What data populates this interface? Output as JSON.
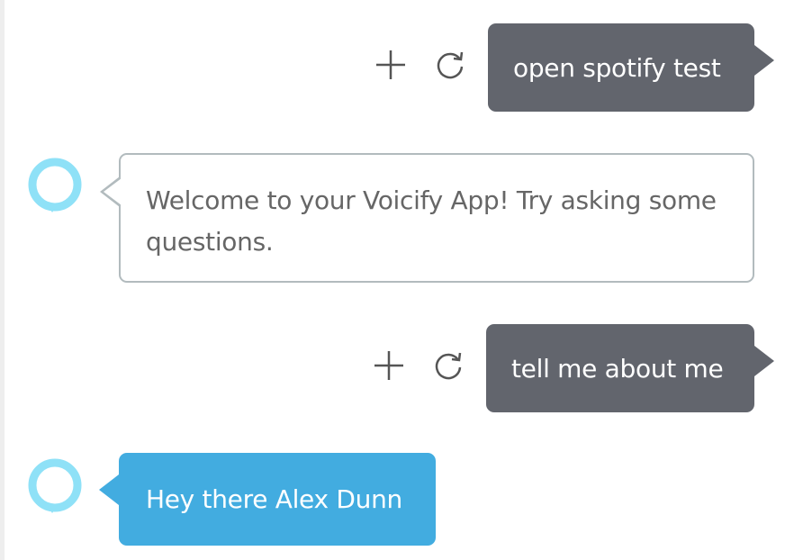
{
  "colors": {
    "user_bubble": "#62656d",
    "bot_bubble_border": "#b2bbbe",
    "bot_bubble_highlight": "#42ace0",
    "avatar_ring": "#8fe1f7",
    "icon_stroke": "#555555"
  },
  "conversation": {
    "messages": [
      {
        "role": "user",
        "text": "open spotify test",
        "actions": [
          "plus-icon",
          "refresh-icon"
        ]
      },
      {
        "role": "assistant",
        "text": "Welcome to your Voicify App! Try asking some questions.",
        "avatar": "alexa-icon"
      },
      {
        "role": "user",
        "text": "tell me about me",
        "actions": [
          "plus-icon",
          "refresh-icon"
        ]
      },
      {
        "role": "assistant",
        "text": "Hey there Alex Dunn",
        "avatar": "alexa-icon",
        "highlighted": true
      }
    ]
  }
}
